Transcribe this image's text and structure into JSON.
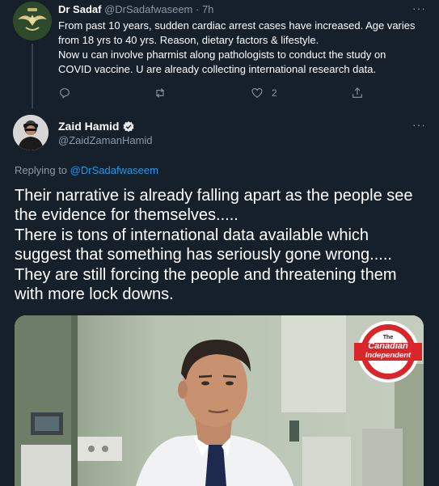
{
  "parent_tweet": {
    "author_name": "Dr Sadaf",
    "author_handle": "@DrSadafwaseem",
    "time": "· 7h",
    "more": "···",
    "lines": [
      "From past 10 years, sudden cardiac arrest cases have increased. Age varies",
      "from 18 yrs to 40 yrs. Reason, dietary factors & lifestyle.",
      "Now u can involve pharmist along  pathologists to conduct the study on",
      "COVID vaccine. U are already collecting international research data."
    ],
    "actions": {
      "reply_count": "",
      "retweet_count": "",
      "like_count": "2",
      "icons": [
        "reply-icon",
        "retweet-icon",
        "like-icon",
        "share-icon"
      ]
    }
  },
  "main_tweet": {
    "author_name": "Zaid Hamid",
    "author_handle": "@ZaidZamanHamid",
    "verified": true,
    "more": "···",
    "replying_to_label": "Replying to",
    "replying_to_handle": "@DrSadafwaseem",
    "text_lines": [
      "Their narrative is already falling apart as the people see",
      "the evidence for themselves.....",
      "There is tons of international data available which",
      "suggest that something has seriously gone wrong.....",
      "They are still forcing the people and threatening them",
      "with more lock downs."
    ],
    "media": {
      "logo_the": "The",
      "logo_line1": "Canadian",
      "logo_line2": "Independent"
    }
  },
  "colors": {
    "background": "#15202b",
    "secondary_text": "#8b98a5",
    "link": "#1d9bf0",
    "logo_red": "#d8262a"
  }
}
